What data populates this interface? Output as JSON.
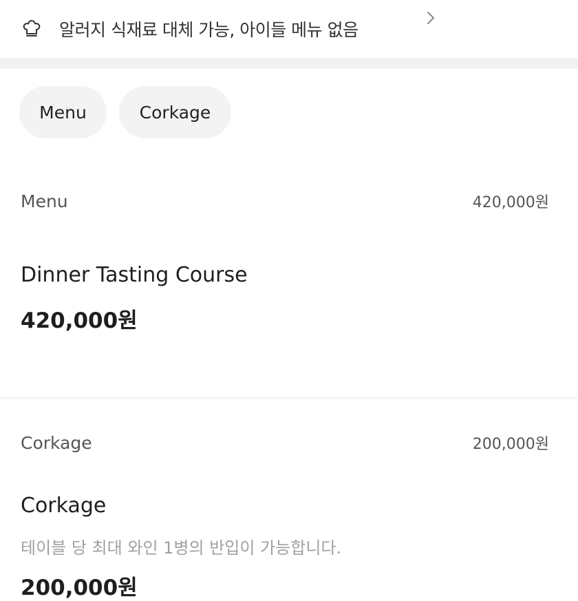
{
  "notice": {
    "text": "알러지 식재료 대체 가능, 아이들 메뉴 없음",
    "icon": "chef-hat-icon"
  },
  "chips": [
    {
      "label": "Menu"
    },
    {
      "label": "Corkage"
    }
  ],
  "sections": [
    {
      "title": "Menu",
      "price": "420,000원",
      "items": [
        {
          "name": "Dinner Tasting Course",
          "price": "420,000원"
        }
      ]
    },
    {
      "title": "Corkage",
      "price": "200,000원",
      "items": [
        {
          "name": "Corkage",
          "description": "테이블 당 최대 와인 1병의 반입이 가능합니다.",
          "price": "200,000원"
        }
      ]
    }
  ],
  "colors": {
    "divider": "#f2f2f2",
    "chip_bg": "#f3f3f3",
    "muted_text": "#a0a0a0"
  }
}
